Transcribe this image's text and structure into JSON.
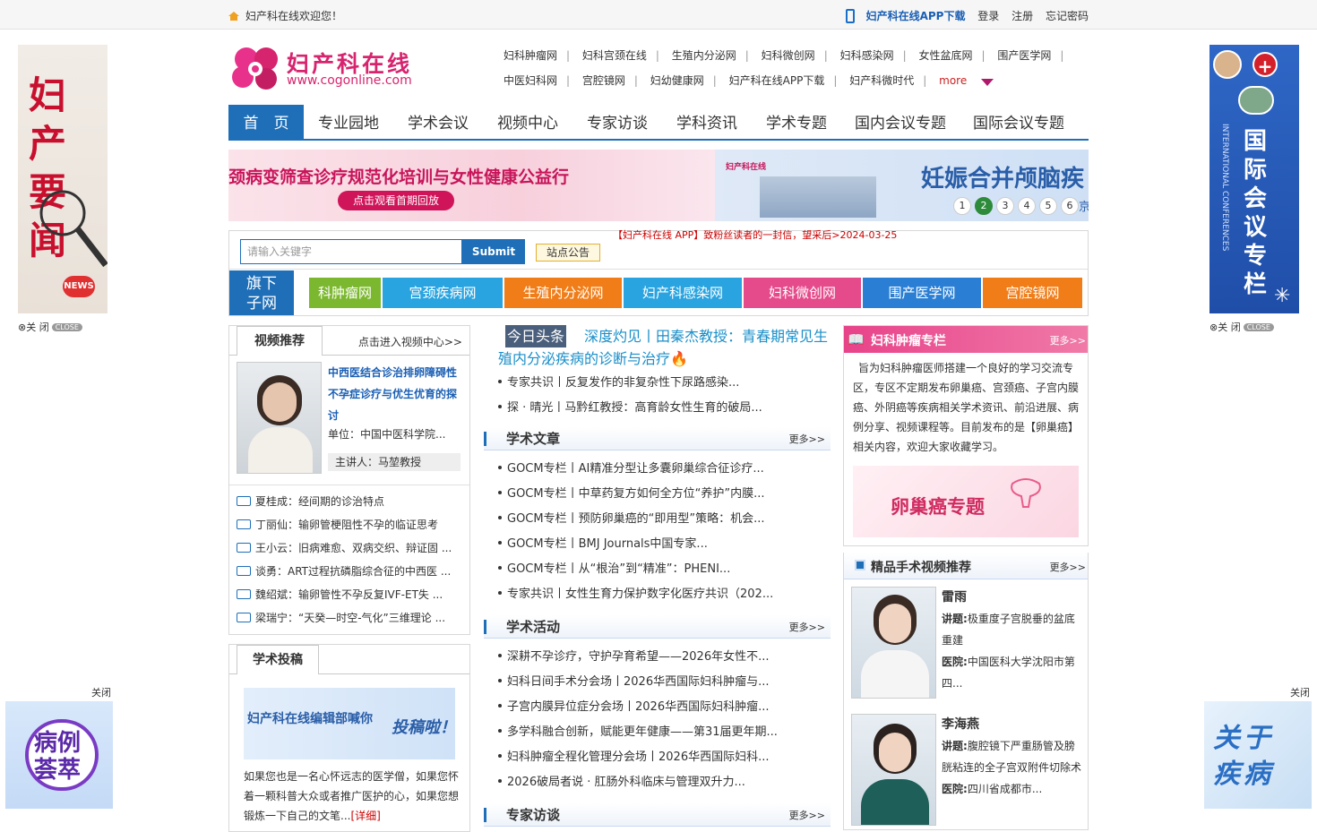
{
  "topbar": {
    "welcome": "妇产科在线欢迎您！",
    "app_download": "妇产科在线APP下载",
    "login": "登录",
    "register": "注册",
    "forgot": "忘记密码"
  },
  "side_ads": {
    "left_top_text": "妇产要闻",
    "left_top_news": "NEWS",
    "right_top_text": "国际会议专栏",
    "right_top_en": "INTERNATIONAL CONFERENCES",
    "close_label": "关 闭",
    "close_badge": "CLOSE",
    "left_bottom_close": "关闭",
    "right_bottom_close": "关闭",
    "left_bottom_text": "病例荟萃",
    "right_bottom_text": "关于疾病"
  },
  "logo": {
    "name": "妇产科在线",
    "url": "www.cogonline.com"
  },
  "sublinks": {
    "row1": [
      "妇科肿瘤网",
      "妇科宫颈在线",
      "生殖内分泌网",
      "妇科微创网",
      "妇科感染网",
      "女性盆底网",
      "围产医学网"
    ],
    "row2": [
      "中医妇科网",
      "宫腔镜网",
      "妇幼健康网",
      "妇产科在线APP下载",
      "妇产科微时代"
    ],
    "more": "more"
  },
  "nav": [
    "首　页",
    "专业园地",
    "学术会议",
    "视频中心",
    "专家访谈",
    "学科资讯",
    "学术专题",
    "国内会议专题",
    "国际会议专题"
  ],
  "banner": {
    "left_title": "颈病变筛查诊疗规范化培训与女性健康公益行",
    "left_button": "点击观看首期回放",
    "right_small": "妇产科在线",
    "right_title": "妊娠合并颅脑疾",
    "right_edge": "京",
    "dots": [
      "1",
      "2",
      "3",
      "4",
      "5",
      "6"
    ],
    "active_dot": 2
  },
  "search": {
    "placeholder": "请输入关键字",
    "submit": "Submit",
    "notice_tag": "站点公告",
    "notice_text": "【妇产科在线 APP】致粉丝读者的一封信，望采后>2024-03-25"
  },
  "subsites": {
    "label": "旗下子网",
    "tabs": [
      {
        "label": "科肿瘤网",
        "color": "#7cb82f"
      },
      {
        "label": "宫颈疾病网",
        "color": "#29a4e0"
      },
      {
        "label": "生殖内分泌网",
        "color": "#f07d18"
      },
      {
        "label": "妇产科感染网",
        "color": "#29a4e0"
      },
      {
        "label": "妇科微创网",
        "color": "#e54a8a"
      },
      {
        "label": "围产医学网",
        "color": "#2a7fd4"
      },
      {
        "label": "宫腔镜网",
        "color": "#f07d18"
      }
    ]
  },
  "video": {
    "tab": "视频推荐",
    "enter": "点击进入视频中心>>",
    "featured_title": "中西医结合诊治排卵障碍性不孕症诊疗与优生优育的探讨",
    "featured_unit": "单位：中国中医科学院...",
    "featured_host": "主讲人：马堃教授",
    "list": [
      "夏桂成：经间期的诊治特点",
      "丁丽仙：输卵管梗阻性不孕的临证思考",
      "王小云：旧病难愈、双病交织、辩证固 ...",
      "谈勇：ART过程抗磷脂综合征的中西医 ...",
      "魏绍斌：输卵管性不孕反复IVF-ET失 ...",
      "梁瑞宁：“天癸—时空-气化”三维理论 ..."
    ]
  },
  "submission": {
    "tab": "学术投稿",
    "banner_text": "妇产科在线编辑部喊你",
    "banner_text2": "投稿啦！",
    "desc": "如果您也是一名心怀远志的医学僧，如果您怀着一颗科普大众或者推广医护的心，如果您想锻炼一下自己的文笔...",
    "detail": "[详细]"
  },
  "headline": {
    "tag": "今日头条",
    "title": "深度灼见丨田秦杰教授：青春期常见生殖内分泌疾病的诊断与治疗",
    "items": [
      "专家共识丨反复发作的非复杂性下尿路感染...",
      "探 · 晴光丨马黔红教授：高育龄女性生育的破局..."
    ]
  },
  "articles": {
    "title": "学术文章",
    "more": "更多>>",
    "items": [
      "GOCM专栏丨AI精准分型让多囊卵巢综合征诊疗...",
      "GOCM专栏丨中草药复方如何全方位“养护”内膜...",
      "GOCM专栏丨预防卵巢癌的“即用型”策略：机会...",
      "GOCM专栏丨BMJ Journals中国专家...",
      "GOCM专栏丨从“根治”到“精准”：PHENI...",
      "专家共识丨女性生育力保护数字化医疗共识（202..."
    ]
  },
  "activities": {
    "title": "学术活动",
    "more": "更多>>",
    "items": [
      "深耕不孕诊疗，守护孕育希望——2026年女性不...",
      "妇科日间手术分会场丨2026华西国际妇科肿瘤与...",
      "子宫内膜异位症分会场丨2026华西国际妇科肿瘤...",
      "多学科融合创新，赋能更年健康——第31届更年期...",
      "妇科肿瘤全程化管理分会场丨2026华西国际妇科...",
      "2026破局者说 · 肛肠外科临床与管理双升力..."
    ]
  },
  "interviews": {
    "title": "专家访谈",
    "more": "更多>>"
  },
  "oncology": {
    "title": "妇科肿瘤专栏",
    "more": "更多>>",
    "desc": "旨为妇科肿瘤医师搭建一个良好的学习交流专区，专区不定期发布卵巢癌、宫颈癌、子宫内膜癌、外阴癌等疾病相关学术资讯、前沿进展、病例分享、视频课程等。目前发布的是【卵巢癌】相关内容，欢迎大家收藏学习。",
    "banner": "卵巢癌专题"
  },
  "surgery_videos": {
    "title": "精品手术视频推荐",
    "more": "更多>>",
    "doctors": [
      {
        "name": "雷雨",
        "topic_label": "讲题:",
        "topic": "极重度子宫脱垂的盆底重建",
        "hosp_label": "医院:",
        "hospital": "中国医科大学沈阳市第四..."
      },
      {
        "name": "李海燕",
        "topic_label": "讲题:",
        "topic": "腹腔镜下严重肠管及膀胱粘连的全子宫双附件切除术",
        "hosp_label": "医院:",
        "hospital": "四川省成都市..."
      }
    ]
  }
}
